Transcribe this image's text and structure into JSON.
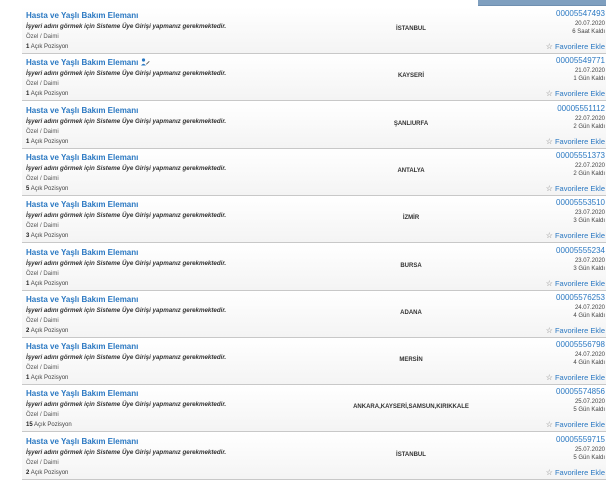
{
  "top_strip_text": "",
  "fav_icon": "star-outline-icon",
  "title_icon": "edit-person-icon",
  "jobs": [
    {
      "title": "Hasta ve Yaşlı Bakım Elemanı",
      "employer_note": "İşyeri adını görmek için Sisteme Üye Girişi yapmanız gerekmektedir.",
      "type": "Özel / Daimi",
      "positions_count": "1",
      "positions_label": "Açık Pozisyon",
      "city": "İSTANBUL",
      "job_no": "00005547493",
      "date": "20.07.2020",
      "days_left": "6 Saat Kaldı",
      "fav_label": "Favorilere Ekle",
      "has_icon": false
    },
    {
      "title": "Hasta ve Yaşlı Bakım Elemanı",
      "employer_note": "İşyeri adını görmek için Sisteme Üye Girişi yapmanız gerekmektedir.",
      "type": "Özel / Daimi",
      "positions_count": "1",
      "positions_label": "Açık Pozisyon",
      "city": "KAYSERİ",
      "job_no": "00005549771",
      "date": "21.07.2020",
      "days_left": "1 Gün Kaldı",
      "fav_label": "Favorilere Ekle",
      "has_icon": true
    },
    {
      "title": "Hasta ve Yaşlı Bakım Elemanı",
      "employer_note": "İşyeri adını görmek için Sisteme Üye Girişi yapmanız gerekmektedir.",
      "type": "Özel / Daimi",
      "positions_count": "1",
      "positions_label": "Açık Pozisyon",
      "city": "ŞANLIURFA",
      "job_no": "00005551112",
      "date": "22.07.2020",
      "days_left": "2 Gün Kaldı",
      "fav_label": "Favorilere Ekle",
      "has_icon": false
    },
    {
      "title": "Hasta ve Yaşlı Bakım Elemanı",
      "employer_note": "İşyeri adını görmek için Sisteme Üye Girişi yapmanız gerekmektedir.",
      "type": "Özel / Daimi",
      "positions_count": "5",
      "positions_label": "Açık Pozisyon",
      "city": "ANTALYA",
      "job_no": "00005551373",
      "date": "22.07.2020",
      "days_left": "2 Gün Kaldı",
      "fav_label": "Favorilere Ekle",
      "has_icon": false
    },
    {
      "title": "Hasta ve Yaşlı Bakım Elemanı",
      "employer_note": "İşyeri adını görmek için Sisteme Üye Girişi yapmanız gerekmektedir.",
      "type": "Özel / Daimi",
      "positions_count": "3",
      "positions_label": "Açık Pozisyon",
      "city": "İZMİR",
      "job_no": "00005553510",
      "date": "23.07.2020",
      "days_left": "3 Gün Kaldı",
      "fav_label": "Favorilere Ekle",
      "has_icon": false
    },
    {
      "title": "Hasta ve Yaşlı Bakım Elemanı",
      "employer_note": "İşyeri adını görmek için Sisteme Üye Girişi yapmanız gerekmektedir.",
      "type": "Özel / Daimi",
      "positions_count": "1",
      "positions_label": "Açık Pozisyon",
      "city": "BURSA",
      "job_no": "00005555234",
      "date": "23.07.2020",
      "days_left": "3 Gün Kaldı",
      "fav_label": "Favorilere Ekle",
      "has_icon": false
    },
    {
      "title": "Hasta ve Yaşlı Bakım Elemanı",
      "employer_note": "İşyeri adını görmek için Sisteme Üye Girişi yapmanız gerekmektedir.",
      "type": "Özel / Daimi",
      "positions_count": "2",
      "positions_label": "Açık Pozisyon",
      "city": "ADANA",
      "job_no": "00005576253",
      "date": "24.07.2020",
      "days_left": "4 Gün Kaldı",
      "fav_label": "Favorilere Ekle",
      "has_icon": false
    },
    {
      "title": "Hasta ve Yaşlı Bakım Elemanı",
      "employer_note": "İşyeri adını görmek için Sisteme Üye Girişi yapmanız gerekmektedir.",
      "type": "Özel / Daimi",
      "positions_count": "1",
      "positions_label": "Açık Pozisyon",
      "city": "MERSİN",
      "job_no": "00005556798",
      "date": "24.07.2020",
      "days_left": "4 Gün Kaldı",
      "fav_label": "Favorilere Ekle",
      "has_icon": false
    },
    {
      "title": "Hasta ve Yaşlı Bakım Elemanı",
      "employer_note": "İşyeri adını görmek için Sisteme Üye Girişi yapmanız gerekmektedir.",
      "type": "Özel / Daimi",
      "positions_count": "15",
      "positions_label": "Açık Pozisyon",
      "city": "ANKARA,KAYSERİ,SAMSUN,KIRIKKALE",
      "job_no": "00005574856",
      "date": "25.07.2020",
      "days_left": "5 Gün Kaldı",
      "fav_label": "Favorilere Ekle",
      "has_icon": false
    },
    {
      "title": "Hasta ve Yaşlı Bakım Elemanı",
      "employer_note": "İşyeri adını görmek için Sisteme Üye Girişi yapmanız gerekmektedir.",
      "type": "Özel / Daimi",
      "positions_count": "2",
      "positions_label": "Açık Pozisyon",
      "city": "İSTANBUL",
      "job_no": "00005559715",
      "date": "25.07.2020",
      "days_left": "5 Gün Kaldı",
      "fav_label": "Favorilere Ekle",
      "has_icon": false
    }
  ]
}
